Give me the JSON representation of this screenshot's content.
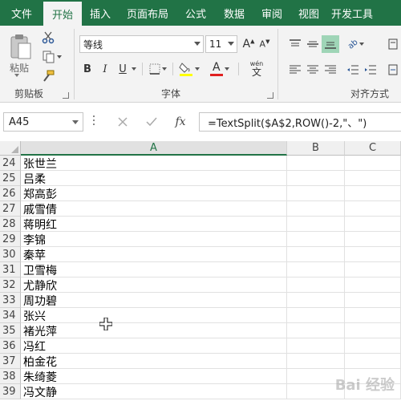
{
  "tabs": [
    "文件",
    "开始",
    "插入",
    "页面布局",
    "公式",
    "数据",
    "审阅",
    "视图",
    "开发工具"
  ],
  "active_tab": "开始",
  "ribbon": {
    "clipboard": {
      "paste_label": "粘贴",
      "group_label": "剪贴板"
    },
    "font": {
      "font_name": "等线",
      "font_size": "11",
      "bold": "B",
      "italic": "I",
      "underline": "U",
      "font_color_letter": "A",
      "phonetic_label": "wén",
      "phonetic_char": "文",
      "group_label": "字体"
    },
    "alignment": {
      "group_label": "对齐方式",
      "orientation_label": "ab"
    }
  },
  "formula_bar": {
    "name_box": "A45",
    "fx_label": "fx",
    "formula": "=TextSplit($A$2,ROW()-2,\"、\")"
  },
  "columns": [
    "A",
    "B",
    "C"
  ],
  "rows": [
    {
      "num": "24",
      "a": "张世兰"
    },
    {
      "num": "25",
      "a": "吕柔"
    },
    {
      "num": "26",
      "a": "郑高彭"
    },
    {
      "num": "27",
      "a": "戚雪倩"
    },
    {
      "num": "28",
      "a": "蒋明红"
    },
    {
      "num": "29",
      "a": "李锦"
    },
    {
      "num": "30",
      "a": "秦苹"
    },
    {
      "num": "31",
      "a": "卫雪梅"
    },
    {
      "num": "32",
      "a": "尤静欣"
    },
    {
      "num": "33",
      "a": "周功碧"
    },
    {
      "num": "34",
      "a": "张兴"
    },
    {
      "num": "35",
      "a": "褚光萍"
    },
    {
      "num": "36",
      "a": "冯红"
    },
    {
      "num": "37",
      "a": "柏金花"
    },
    {
      "num": "38",
      "a": "朱绮菱"
    },
    {
      "num": "39",
      "a": "冯文静"
    }
  ],
  "watermark": "Bai 经验",
  "colors": {
    "excel_green": "#217346",
    "font_color_bar": "#e02020",
    "highlight_bar": "#ffff00"
  }
}
